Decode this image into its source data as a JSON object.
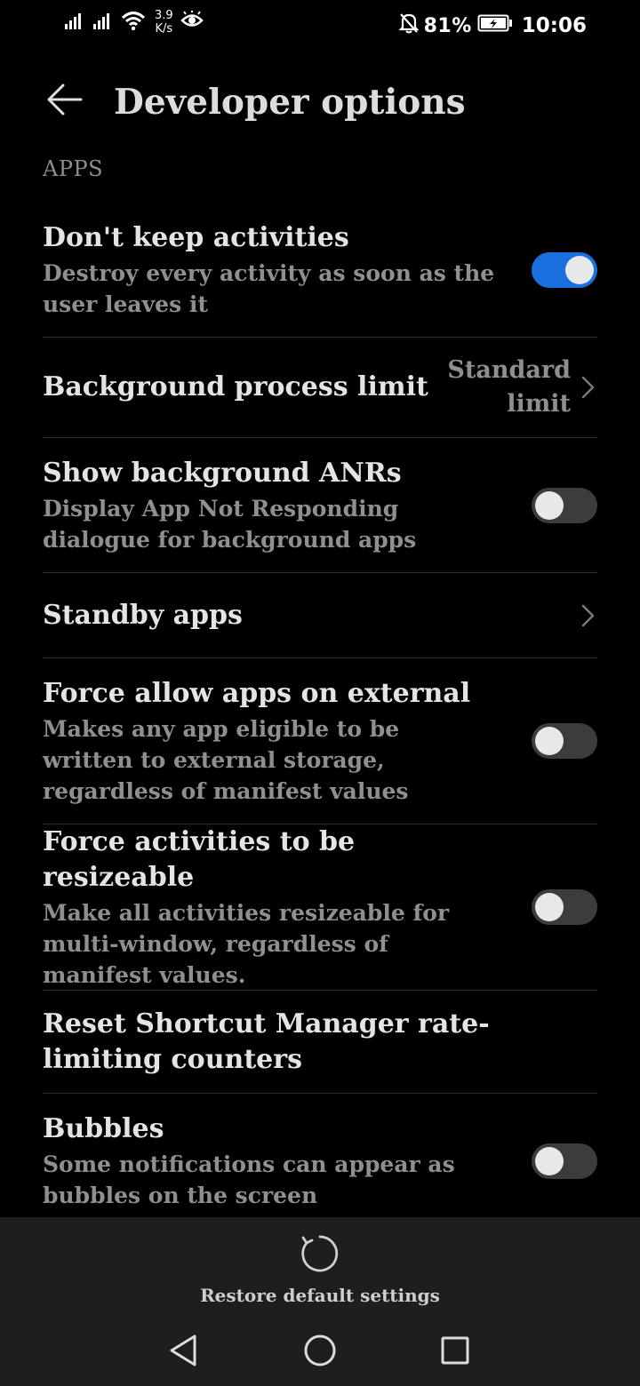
{
  "status_bar": {
    "network_speed_value": "3.9",
    "network_speed_unit": "K/s",
    "battery_percent": "81%",
    "time": "10:06",
    "icons": [
      "signal-icon",
      "signal-icon",
      "wifi-icon",
      "eye-icon",
      "mute-bell-icon",
      "battery-charging-icon"
    ]
  },
  "header": {
    "title": "Developer options",
    "back_icon": "back-arrow-icon"
  },
  "section": {
    "label": "APPS"
  },
  "settings": [
    {
      "title": "Don't keep activities",
      "summary": "Destroy every activity as soon as the user leaves it",
      "control": "toggle",
      "enabled": true
    },
    {
      "title": "Background process limit",
      "value": "Standard limit",
      "control": "chevron"
    },
    {
      "title": "Show background ANRs",
      "summary": "Display App Not Responding dialogue for background apps",
      "control": "toggle",
      "enabled": false
    },
    {
      "title": "Standby apps",
      "control": "chevron"
    },
    {
      "title": "Force allow apps on external",
      "summary": "Makes any app eligible to be written to external storage, regardless of manifest values",
      "control": "toggle",
      "enabled": false
    },
    {
      "title": "Force activities to be resizeable",
      "summary": "Make all activities resizeable for multi-window, regardless of manifest values.",
      "control": "toggle",
      "enabled": false
    },
    {
      "title": "Reset Shortcut Manager rate-limiting counters"
    },
    {
      "title": "Bubbles",
      "summary": "Some notifications can appear as bubbles on the screen",
      "control": "toggle",
      "enabled": false
    }
  ],
  "bottom_bar": {
    "restore_label": "Restore default settings",
    "restore_icon": "restore-icon"
  },
  "nav_bar": {
    "icons": [
      "nav-back-icon",
      "nav-home-icon",
      "nav-recents-icon"
    ]
  },
  "colors": {
    "background": "#000000",
    "toggle_on": "#1a6fe0",
    "toggle_off": "#3c3c3c",
    "bottom_bar": "#1e1e1e"
  }
}
